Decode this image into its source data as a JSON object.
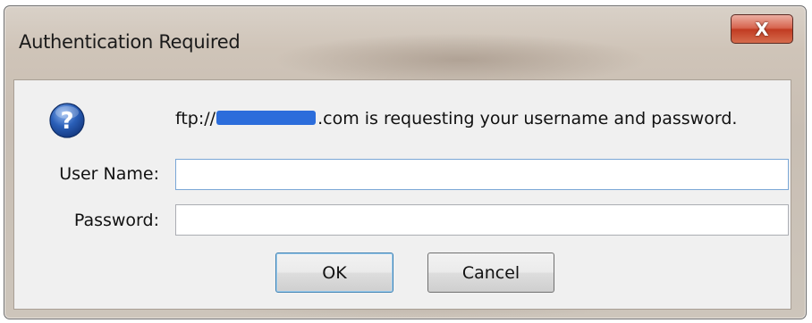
{
  "dialog": {
    "title": "Authentication Required",
    "close_label": "X"
  },
  "message": {
    "prefix": "ftp://",
    "suffix": ".com is requesting your username and password.",
    "icon": "question-icon"
  },
  "form": {
    "username_label": "User Name:",
    "username_value": "",
    "password_label": "Password:",
    "password_value": ""
  },
  "buttons": {
    "ok_label": "OK",
    "cancel_label": "Cancel"
  },
  "colors": {
    "close_button": "#c13b22",
    "icon_blue": "#2a5fb8",
    "redaction": "#2c6ddb"
  }
}
